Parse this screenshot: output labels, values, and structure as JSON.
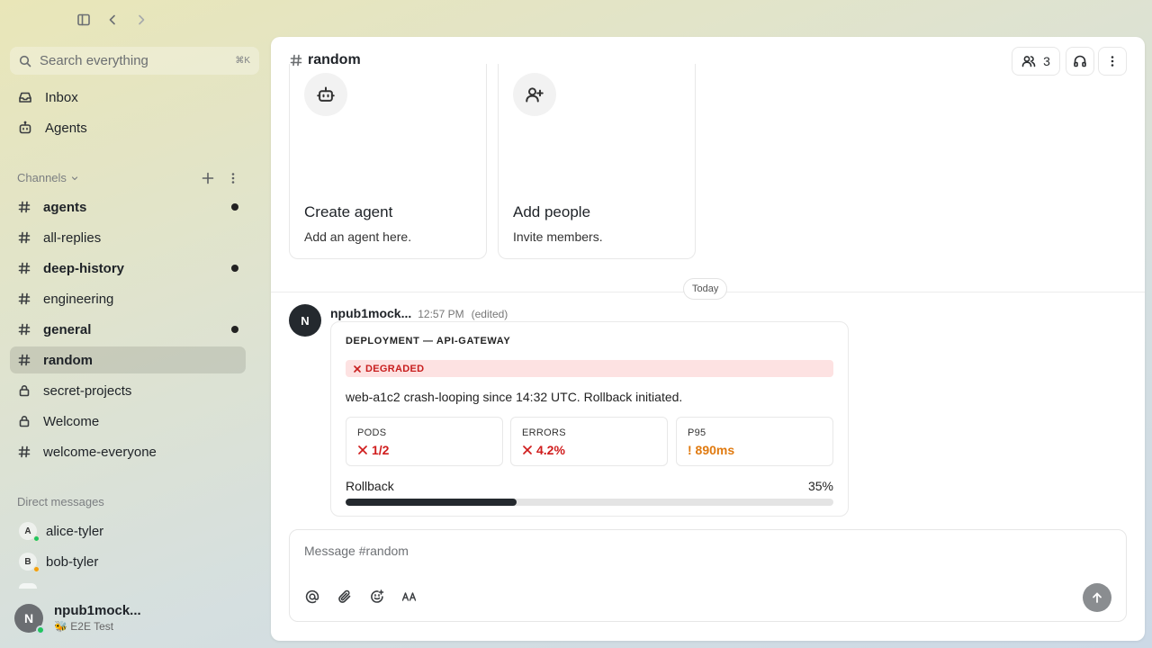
{
  "search": {
    "placeholder": "Search everything",
    "shortcut": "⌘K"
  },
  "nav": [
    {
      "label": "Inbox",
      "icon": "inbox-icon"
    },
    {
      "label": "Agents",
      "icon": "bot-icon"
    }
  ],
  "channels_header": "Channels",
  "channels": [
    {
      "name": "agents",
      "unread": true,
      "icon": "hash-icon"
    },
    {
      "name": "all-replies",
      "unread": false,
      "icon": "hash-icon"
    },
    {
      "name": "deep-history",
      "unread": true,
      "icon": "hash-icon"
    },
    {
      "name": "engineering",
      "unread": false,
      "icon": "hash-icon"
    },
    {
      "name": "general",
      "unread": true,
      "icon": "hash-icon"
    },
    {
      "name": "random",
      "active": true,
      "icon": "hash-icon"
    },
    {
      "name": "secret-projects",
      "icon": "lock-icon"
    },
    {
      "name": "Welcome",
      "icon": "lock-icon"
    },
    {
      "name": "welcome-everyone",
      "icon": "hash-icon"
    }
  ],
  "dm_header": "Direct messages",
  "dms": [
    {
      "initial": "A",
      "name": "alice-tyler",
      "status_color": "#22c55e"
    },
    {
      "initial": "B",
      "name": "bob-tyler",
      "status_color": "#f59e0b"
    }
  ],
  "user": {
    "initial": "N",
    "name": "npub1mock...",
    "status": "🐝 E2E Test"
  },
  "header": {
    "channel": "random",
    "members": "3"
  },
  "cards": [
    {
      "title": "Create agent",
      "subtitle": "Add an agent here.",
      "icon": "bot-icon"
    },
    {
      "title": "Add people",
      "subtitle": "Invite members.",
      "icon": "user-plus-icon"
    }
  ],
  "date_divider": "Today",
  "message": {
    "avatar": "N",
    "author": "npub1mock...",
    "time": "12:57 PM",
    "edited": "(edited)",
    "card": {
      "title": "DEPLOYMENT — API-GATEWAY",
      "status": "DEGRADED",
      "description": "web-a1c2 crash-looping since 14:32 UTC. Rollback initiated.",
      "metrics": [
        {
          "label": "PODS",
          "value": "1/2",
          "prefix": "✕",
          "tone": "red"
        },
        {
          "label": "ERRORS",
          "value": "4.2%",
          "prefix": "✕",
          "tone": "red"
        },
        {
          "label": "P95",
          "value": "! 890ms",
          "prefix": "",
          "tone": "orange"
        }
      ],
      "progress_label": "Rollback",
      "progress_text": "35%",
      "progress_value": 0.35
    }
  },
  "composer": {
    "placeholder": "Message #random"
  },
  "colors": {
    "danger": "#d01c1c",
    "warning": "#e07a10",
    "progress": "#24292e"
  }
}
